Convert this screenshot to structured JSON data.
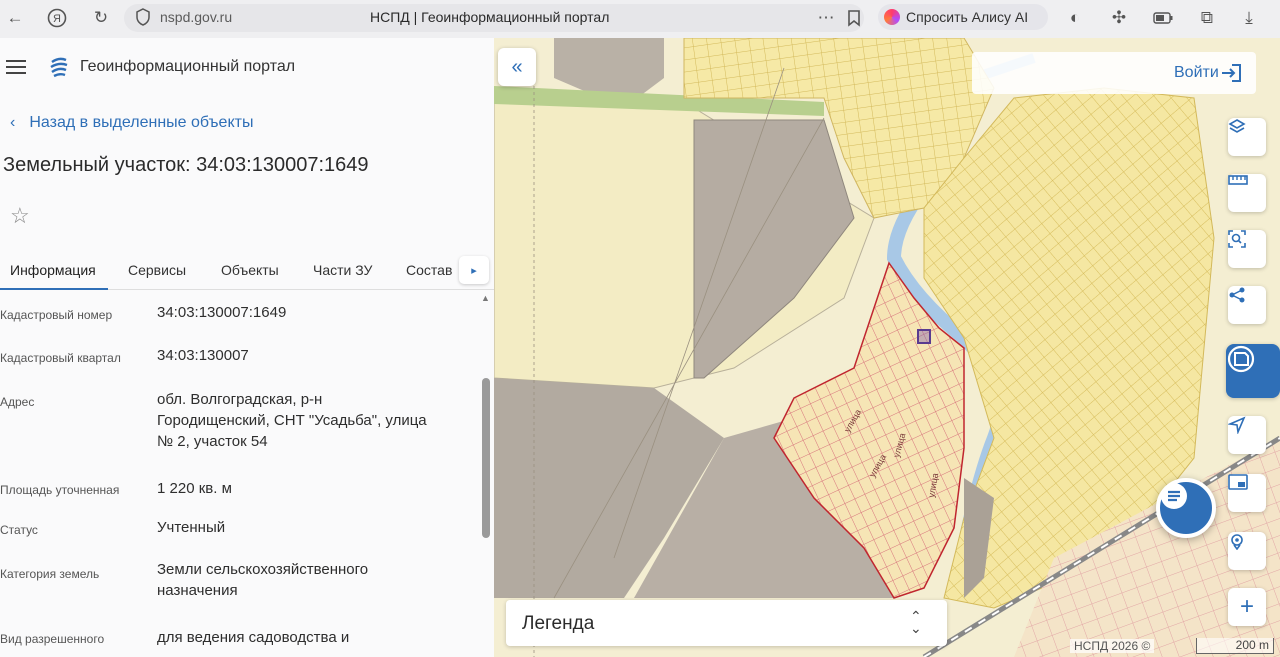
{
  "browser": {
    "url": "nspd.gov.ru",
    "tab_title": "НСПД | Геоинформационный портал",
    "alice_label": "Спросить Алису AI",
    "icons": [
      "back-icon",
      "yandex-icon",
      "reload-icon",
      "shield-icon",
      "more-icon",
      "bookmark-icon",
      "alice-icon",
      "globe-icon",
      "extensions-icon",
      "battery-icon",
      "collections-icon",
      "download-icon"
    ]
  },
  "header": {
    "portal_title": "Геоинформационный портал"
  },
  "panel": {
    "back_label": "Назад в выделенные объекты",
    "title": "Земельный участок: 34:03:130007:1649",
    "tabs": [
      "Информация",
      "Сервисы",
      "Объекты",
      "Части ЗУ",
      "Состав"
    ],
    "active_tab": "Информация",
    "fields": [
      {
        "label": "Кадастровый номер",
        "value": "34:03:130007:1649"
      },
      {
        "label": "Кадастровый квартал",
        "value": "34:03:130007"
      },
      {
        "label": "Адрес",
        "value": "обл. Волгоградская, р-н Городищенский, СНТ \"Усадьба\", улица № 2, участок 54"
      },
      {
        "label": "Площадь уточненная",
        "value": "1 220 кв. м"
      },
      {
        "label": "Статус",
        "value": "Учтенный"
      },
      {
        "label": "Категория земель",
        "value": "Земли сельскохозяйственного назначения"
      },
      {
        "label": "Вид разрешенного",
        "value": "для ведения садоводства и"
      }
    ]
  },
  "map": {
    "login_label": "Войти",
    "legend_label": "Легенда",
    "copyright": "НСПД 2026 ©",
    "scale_label": "200 m",
    "tools": [
      "layers-icon",
      "ruler-icon",
      "search-area-icon",
      "share-icon",
      "info-map-icon",
      "navigate-icon",
      "minimap-icon",
      "location-icon",
      "zoom-in-icon"
    ],
    "colors": {
      "accent": "#2f6fb7",
      "parcel_fill": "#f6e9a6",
      "parcel_stroke": "#d3b95a",
      "selected_stroke": "#c0262f",
      "river": "#a8c8e6"
    }
  }
}
